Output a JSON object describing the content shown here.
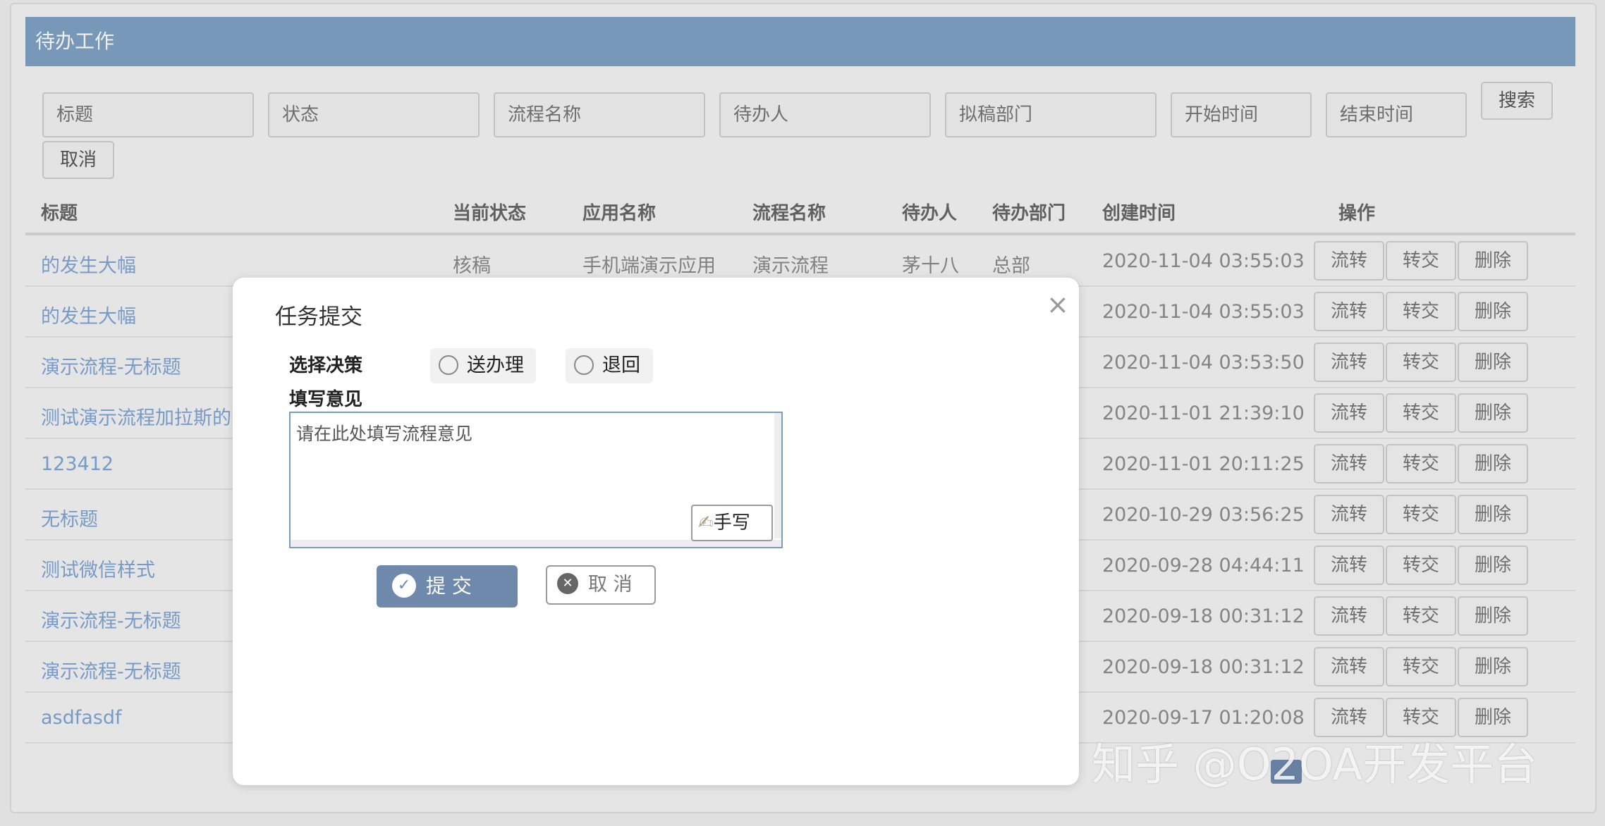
{
  "header": {
    "title": "待办工作"
  },
  "search": {
    "fields": [
      {
        "placeholder": "标题"
      },
      {
        "placeholder": "状态"
      },
      {
        "placeholder": "流程名称"
      },
      {
        "placeholder": "待办人"
      },
      {
        "placeholder": "拟稿部门"
      },
      {
        "placeholder": "开始时间"
      },
      {
        "placeholder": "结束时间"
      }
    ],
    "search_label": "搜索",
    "cancel_label": "取消"
  },
  "table": {
    "columns": [
      "标题",
      "当前状态",
      "应用名称",
      "流程名称",
      "待办人",
      "待办部门",
      "创建时间",
      "操作"
    ],
    "actions": [
      "流转",
      "转交",
      "删除"
    ],
    "rows": [
      {
        "title": "的发生大幅",
        "status": "核稿",
        "app": "手机端演示应用",
        "process": "演示流程",
        "assignee": "茅十八",
        "dept": "总部",
        "created": "2020-11-04 03:55:03"
      },
      {
        "title": "的发生大幅",
        "status": "",
        "app": "",
        "process": "",
        "assignee": "",
        "dept": "",
        "created": "2020-11-04 03:55:03"
      },
      {
        "title": "演示流程-无标题",
        "status": "",
        "app": "",
        "process": "",
        "assignee": "",
        "dept": "",
        "created": "2020-11-04 03:53:50"
      },
      {
        "title": "测试演示流程加拉斯的",
        "status": "",
        "app": "",
        "process": "",
        "assignee": "",
        "dept": "",
        "created": "2020-11-01 21:39:10"
      },
      {
        "title": "123412",
        "status": "",
        "app": "",
        "process": "",
        "assignee": "",
        "dept": "",
        "created": "2020-11-01 20:11:25"
      },
      {
        "title": "无标题",
        "status": "",
        "app": "",
        "process": "",
        "assignee": "",
        "dept": "",
        "created": "2020-10-29 03:56:25"
      },
      {
        "title": "测试微信样式",
        "status": "",
        "app": "",
        "process": "",
        "assignee": "",
        "dept": "",
        "created": "2020-09-28 04:44:11"
      },
      {
        "title": "演示流程-无标题",
        "status": "",
        "app": "",
        "process": "",
        "assignee": "",
        "dept": "",
        "created": "2020-09-18 00:31:12"
      },
      {
        "title": "演示流程-无标题",
        "status": "",
        "app": "",
        "process": "",
        "assignee": "",
        "dept": "",
        "created": "2020-09-18 00:31:12"
      },
      {
        "title": "asdfasdf",
        "status": "",
        "app": "",
        "process": "",
        "assignee": "",
        "dept": "",
        "created": "2020-09-17 01:20:08"
      }
    ]
  },
  "dialog": {
    "title": "任务提交",
    "close": "×",
    "decision_label": "选择决策",
    "options": [
      "送办理",
      "退回"
    ],
    "opinion_label": "填写意见",
    "opinion_placeholder": "请在此处填写流程意见",
    "handwrite_label": "手写",
    "submit_label": "提 交",
    "cancel_label": "取 消"
  },
  "watermark": "知乎 @O2OA开发平台",
  "colors": {
    "header": "#80a2c6",
    "link": "#7fa5d3",
    "primary_button": "#6f89ad"
  }
}
